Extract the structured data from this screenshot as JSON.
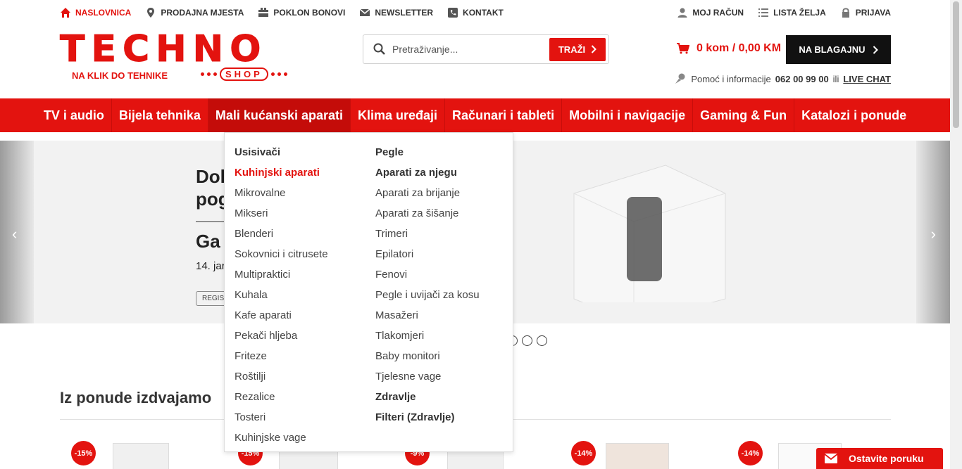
{
  "topbar": {
    "left": [
      {
        "label": "NASLOVNICA",
        "icon": "home-icon"
      },
      {
        "label": "PRODAJNA MJESTA",
        "icon": "location-pin-icon"
      },
      {
        "label": "POKLON BONOVI",
        "icon": "gift-card-icon"
      },
      {
        "label": "NEWSLETTER",
        "icon": "envelope-icon"
      },
      {
        "label": "KONTAKT",
        "icon": "phone-icon"
      }
    ],
    "right": [
      {
        "label": "MOJ RAČUN",
        "icon": "user-icon"
      },
      {
        "label": "LISTA ŽELJA",
        "icon": "list-icon"
      },
      {
        "label": "PRIJAVA",
        "icon": "lock-icon"
      }
    ]
  },
  "logo": {
    "main": "TECHNO",
    "shop": "SHOP",
    "tagline": "NA KLIK DO TEHNIKE"
  },
  "search": {
    "placeholder": "Pretraživanje...",
    "button": "TRAŽI"
  },
  "cart": {
    "text": "0 kom / 0,00 KM",
    "checkout": "NA BLAGAJNU"
  },
  "help": {
    "text": "Pomoć i informacije",
    "phone": "062 00 99 00",
    "or": "ili",
    "live_chat": "LIVE CHAT"
  },
  "nav": [
    "TV i audio",
    "Bijela tehnika",
    "Mali kućanski aparati",
    "Klima uređaji",
    "Računari i tableti",
    "Mobilni i navigacije",
    "Gaming & Fun",
    "Katalozi i ponude"
  ],
  "dropdown": {
    "col1": [
      "Usisivači",
      "Kuhinjski aparati",
      "Mikrovalne",
      "Mikseri",
      "Blenderi",
      "Sokovnici i citrusete",
      "Multipraktici",
      "Kuhala",
      "Kafe aparati",
      "Pekači hljeba",
      "Friteze",
      "Roštilji",
      "Rezalice",
      "Tosteri",
      "Kuhinjske vage"
    ],
    "col2": [
      "Pegle",
      "Aparati za njegu",
      "Aparati za brijanje",
      "Aparati za šišanje",
      "Trimeri",
      "Epilatori",
      "Fenovi",
      "Pegle i uvijači za kosu",
      "Masažeri",
      "Tlakomjeri",
      "Baby monitori",
      "Tjelesne vage",
      "Zdravlje",
      "Filteri (Zdravlje)"
    ]
  },
  "banner": {
    "line1": "Dol",
    "line2": "pog",
    "line3": "Ga",
    "date": "14. jar",
    "button": "REGIS"
  },
  "section": {
    "title": "Iz ponude izdvajamo"
  },
  "badges": [
    "-15%",
    "-15%",
    "-9%",
    "-14%",
    "-14%"
  ],
  "chat": {
    "label": "Ostavite poruku"
  }
}
